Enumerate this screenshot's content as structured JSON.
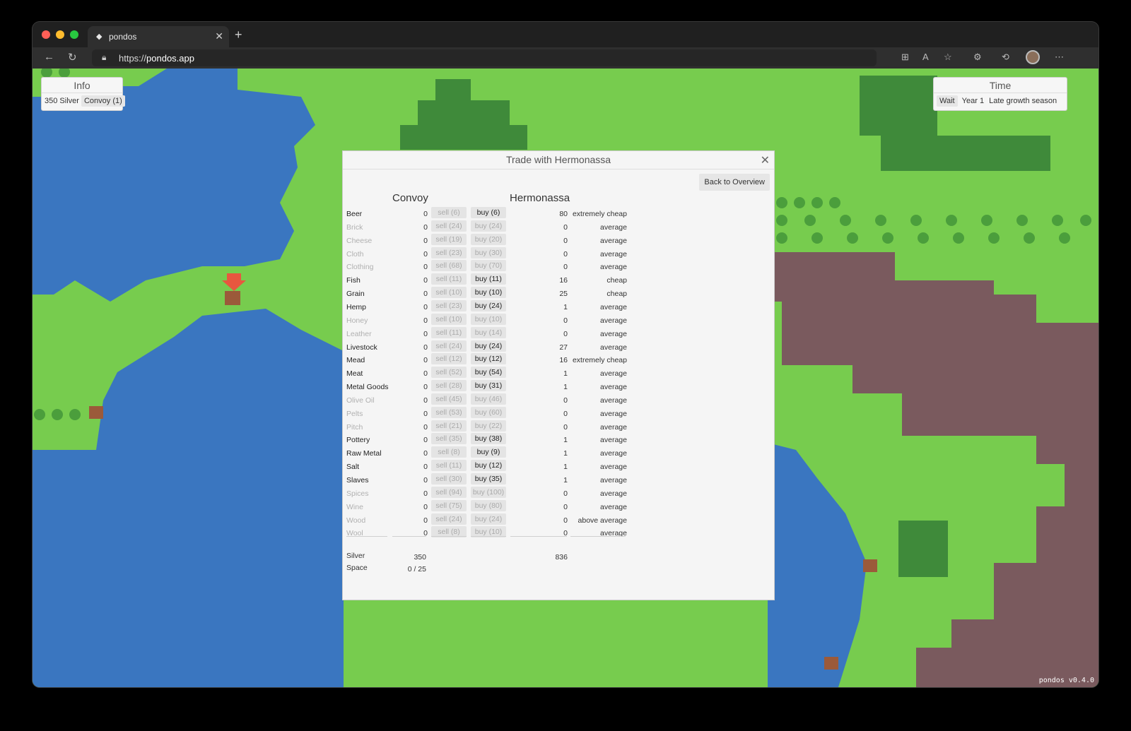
{
  "browser": {
    "tab_title": "pondos",
    "url_scheme": "https://",
    "url_host": "pondos.app"
  },
  "info_panel": {
    "title": "Info",
    "silver": "350 Silver",
    "convoy_label": "Convoy (1)"
  },
  "time_panel": {
    "title": "Time",
    "wait_label": "Wait",
    "year": "Year 1",
    "season": "Late growth season"
  },
  "version": "pondos v0.4.0",
  "trade": {
    "title": "Trade with Hermonassa",
    "back_label": "Back to Overview",
    "convoy_header": "Convoy",
    "city_header": "Hermonassa",
    "goods": [
      {
        "name": "Beer",
        "convoy": "0",
        "sell": "sell (6)",
        "buy": "buy (6)",
        "stock": "80",
        "price": "extremely cheap",
        "available": true
      },
      {
        "name": "Brick",
        "convoy": "0",
        "sell": "sell (24)",
        "buy": "buy (24)",
        "stock": "0",
        "price": "average",
        "available": false
      },
      {
        "name": "Cheese",
        "convoy": "0",
        "sell": "sell (19)",
        "buy": "buy (20)",
        "stock": "0",
        "price": "average",
        "available": false
      },
      {
        "name": "Cloth",
        "convoy": "0",
        "sell": "sell (23)",
        "buy": "buy (30)",
        "stock": "0",
        "price": "average",
        "available": false
      },
      {
        "name": "Clothing",
        "convoy": "0",
        "sell": "sell (68)",
        "buy": "buy (70)",
        "stock": "0",
        "price": "average",
        "available": false
      },
      {
        "name": "Fish",
        "convoy": "0",
        "sell": "sell (11)",
        "buy": "buy (11)",
        "stock": "16",
        "price": "cheap",
        "available": true
      },
      {
        "name": "Grain",
        "convoy": "0",
        "sell": "sell (10)",
        "buy": "buy (10)",
        "stock": "25",
        "price": "cheap",
        "available": true
      },
      {
        "name": "Hemp",
        "convoy": "0",
        "sell": "sell (23)",
        "buy": "buy (24)",
        "stock": "1",
        "price": "average",
        "available": true
      },
      {
        "name": "Honey",
        "convoy": "0",
        "sell": "sell (10)",
        "buy": "buy (10)",
        "stock": "0",
        "price": "average",
        "available": false
      },
      {
        "name": "Leather",
        "convoy": "0",
        "sell": "sell (11)",
        "buy": "buy (14)",
        "stock": "0",
        "price": "average",
        "available": false
      },
      {
        "name": "Livestock",
        "convoy": "0",
        "sell": "sell (24)",
        "buy": "buy (24)",
        "stock": "27",
        "price": "average",
        "available": true
      },
      {
        "name": "Mead",
        "convoy": "0",
        "sell": "sell (12)",
        "buy": "buy (12)",
        "stock": "16",
        "price": "extremely cheap",
        "available": true
      },
      {
        "name": "Meat",
        "convoy": "0",
        "sell": "sell (52)",
        "buy": "buy (54)",
        "stock": "1",
        "price": "average",
        "available": true
      },
      {
        "name": "Metal Goods",
        "convoy": "0",
        "sell": "sell (28)",
        "buy": "buy (31)",
        "stock": "1",
        "price": "average",
        "available": true
      },
      {
        "name": "Olive Oil",
        "convoy": "0",
        "sell": "sell (45)",
        "buy": "buy (46)",
        "stock": "0",
        "price": "average",
        "available": false
      },
      {
        "name": "Pelts",
        "convoy": "0",
        "sell": "sell (53)",
        "buy": "buy (60)",
        "stock": "0",
        "price": "average",
        "available": false
      },
      {
        "name": "Pitch",
        "convoy": "0",
        "sell": "sell (21)",
        "buy": "buy (22)",
        "stock": "0",
        "price": "average",
        "available": false
      },
      {
        "name": "Pottery",
        "convoy": "0",
        "sell": "sell (35)",
        "buy": "buy (38)",
        "stock": "1",
        "price": "average",
        "available": true
      },
      {
        "name": "Raw Metal",
        "convoy": "0",
        "sell": "sell (8)",
        "buy": "buy (9)",
        "stock": "1",
        "price": "average",
        "available": true
      },
      {
        "name": "Salt",
        "convoy": "0",
        "sell": "sell (11)",
        "buy": "buy (12)",
        "stock": "1",
        "price": "average",
        "available": true
      },
      {
        "name": "Slaves",
        "convoy": "0",
        "sell": "sell (30)",
        "buy": "buy (35)",
        "stock": "1",
        "price": "average",
        "available": true
      },
      {
        "name": "Spices",
        "convoy": "0",
        "sell": "sell (94)",
        "buy": "buy (100)",
        "stock": "0",
        "price": "average",
        "available": false
      },
      {
        "name": "Wine",
        "convoy": "0",
        "sell": "sell (75)",
        "buy": "buy (80)",
        "stock": "0",
        "price": "average",
        "available": false
      },
      {
        "name": "Wood",
        "convoy": "0",
        "sell": "sell (24)",
        "buy": "buy (24)",
        "stock": "0",
        "price": "above average",
        "available": false
      },
      {
        "name": "Wool",
        "convoy": "0",
        "sell": "sell (8)",
        "buy": "buy (10)",
        "stock": "0",
        "price": "average",
        "available": false
      }
    ],
    "footer": {
      "silver_label": "Silver",
      "convoy_silver": "350",
      "city_silver": "836",
      "space_label": "Space",
      "convoy_space": "0 / 25"
    }
  },
  "colors": {
    "grass": "#77cc4e",
    "water": "#3a76c0",
    "forest": "#3f8a3a",
    "mountain": "#7a5a5e"
  }
}
